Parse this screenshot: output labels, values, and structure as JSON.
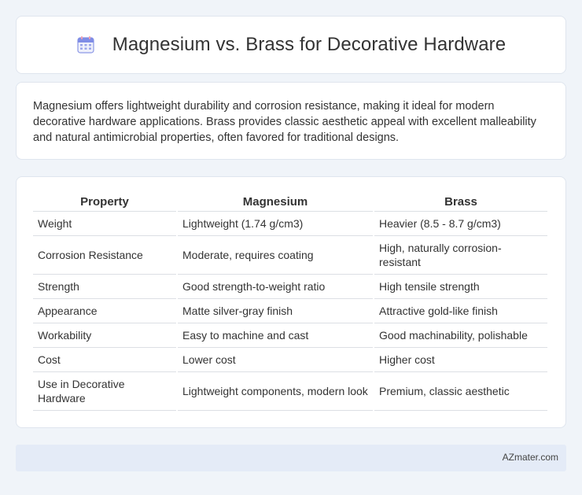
{
  "header": {
    "icon": "calendar-icon",
    "title": "Magnesium vs. Brass for Decorative Hardware"
  },
  "description": "Magnesium offers lightweight durability and corrosion resistance, making it ideal for modern decorative hardware applications. Brass provides classic aesthetic appeal with excellent malleability and natural antimicrobial properties, often favored for traditional designs.",
  "table": {
    "headers": [
      "Property",
      "Magnesium",
      "Brass"
    ],
    "rows": [
      [
        "Weight",
        "Lightweight (1.74 g/cm3)",
        "Heavier (8.5 - 8.7 g/cm3)"
      ],
      [
        "Corrosion Resistance",
        "Moderate, requires coating",
        "High, naturally corrosion-resistant"
      ],
      [
        "Strength",
        "Good strength-to-weight ratio",
        "High tensile strength"
      ],
      [
        "Appearance",
        "Matte silver-gray finish",
        "Attractive gold-like finish"
      ],
      [
        "Workability",
        "Easy to machine and cast",
        "Good machinability, polishable"
      ],
      [
        "Cost",
        "Lower cost",
        "Higher cost"
      ],
      [
        "Use in Decorative Hardware",
        "Lightweight components, modern look",
        "Premium, classic aesthetic"
      ]
    ]
  },
  "footer": {
    "brand": "AZmater.com"
  },
  "colors": {
    "background": "#f0f4f9",
    "card": "#ffffff",
    "footer": "#e4ebf7",
    "icon_primary": "#7f8de6",
    "icon_accent": "#f0a0b0"
  }
}
